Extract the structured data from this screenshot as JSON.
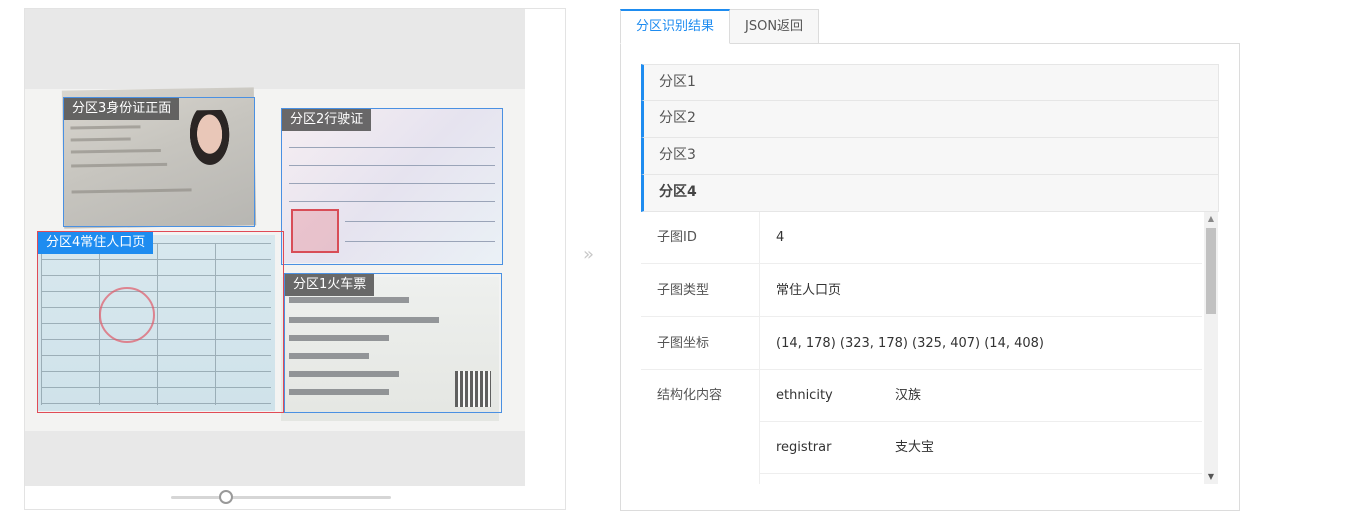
{
  "regions": [
    {
      "label": "分区3身份证正面"
    },
    {
      "label": "分区2行驶证"
    },
    {
      "label": "分区4常住人口页"
    },
    {
      "label": "分区1火车票"
    }
  ],
  "arrow_glyph": "»",
  "tabs": [
    {
      "label": "分区识别结果",
      "active": true
    },
    {
      "label": "JSON返回",
      "active": false
    }
  ],
  "partitions": [
    "分区1",
    "分区2",
    "分区3",
    "分区4"
  ],
  "detail": {
    "sub_id_key": "子图ID",
    "sub_id_value": "4",
    "sub_type_key": "子图类型",
    "sub_type_value": "常住人口页",
    "coords_key": "子图坐标",
    "coords_value": "(14, 178) (323, 178) (325, 407) (14, 408)",
    "structured_key": "结构化内容",
    "structured": [
      {
        "key": "ethnicity",
        "value": "汉族"
      },
      {
        "key": "registrar",
        "value": "支大宝"
      }
    ]
  },
  "colors": {
    "accent": "#1e8cf0",
    "active_region": "#e04b56",
    "region_border": "#4a90e2"
  }
}
